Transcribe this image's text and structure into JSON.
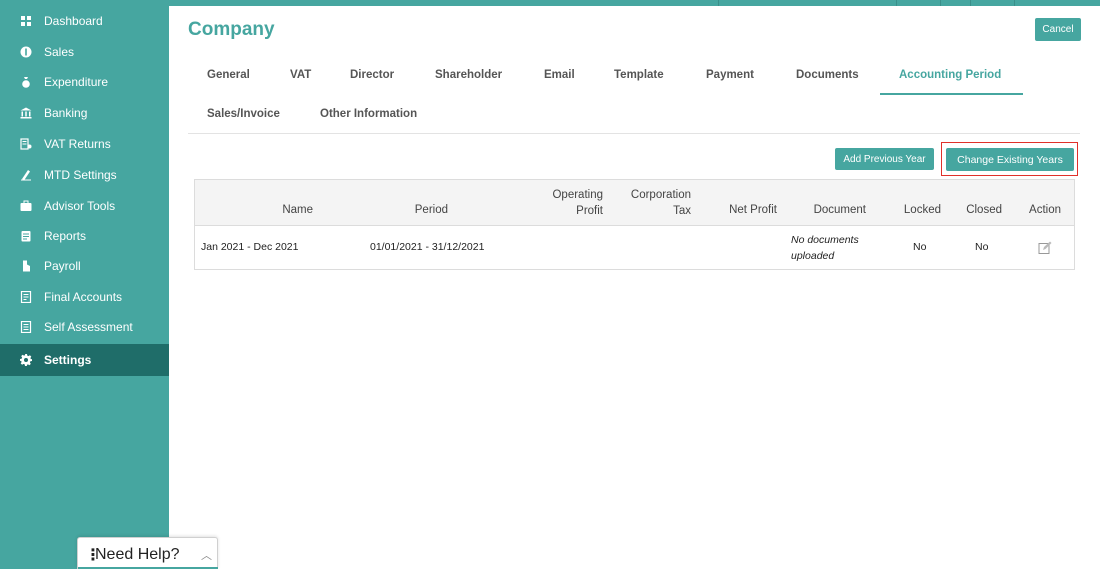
{
  "colors": {
    "accent": "#46a6a0",
    "sidebar_active": "#1f6d69",
    "highlight": "#e0312a"
  },
  "sidebar": {
    "items": [
      {
        "label": "Dashboard",
        "icon": "dashboard-icon"
      },
      {
        "label": "Sales",
        "icon": "sales-icon"
      },
      {
        "label": "Expenditure",
        "icon": "expenditure-icon"
      },
      {
        "label": "Banking",
        "icon": "bank-icon"
      },
      {
        "label": "VAT Returns",
        "icon": "vat-returns-icon"
      },
      {
        "label": "MTD Settings",
        "icon": "mtd-settings-icon"
      },
      {
        "label": "Advisor Tools",
        "icon": "briefcase-icon"
      },
      {
        "label": "Reports",
        "icon": "reports-icon"
      },
      {
        "label": "Payroll",
        "icon": "payroll-icon"
      },
      {
        "label": "Final Accounts",
        "icon": "final-accounts-icon"
      },
      {
        "label": "Self Assessment",
        "icon": "self-assessment-icon"
      },
      {
        "label": "Settings",
        "icon": "gear-icon",
        "active": true
      }
    ]
  },
  "header": {
    "title": "Company",
    "cancel_label": "Cancel"
  },
  "tabs": [
    {
      "label": "General"
    },
    {
      "label": "VAT"
    },
    {
      "label": "Director"
    },
    {
      "label": "Shareholder"
    },
    {
      "label": "Email"
    },
    {
      "label": "Template"
    },
    {
      "label": "Payment"
    },
    {
      "label": "Documents"
    },
    {
      "label": "Accounting Period",
      "active": true
    },
    {
      "label": "Sales/Invoice"
    },
    {
      "label": "Other Information"
    }
  ],
  "actions": {
    "add_previous_year": "Add Previous Year",
    "change_existing_years": "Change Existing Years"
  },
  "table": {
    "columns": [
      {
        "lines": [
          "Name"
        ]
      },
      {
        "lines": [
          "Period"
        ]
      },
      {
        "lines": [
          "Operating",
          "Profit"
        ]
      },
      {
        "lines": [
          "Corporation",
          "Tax"
        ]
      },
      {
        "lines": [
          "Net Profit"
        ]
      },
      {
        "lines": [
          "Document"
        ]
      },
      {
        "lines": [
          "Locked"
        ]
      },
      {
        "lines": [
          "Closed"
        ]
      },
      {
        "lines": [
          "Action"
        ]
      }
    ],
    "rows": [
      {
        "name": "Jan 2021 - Dec 2021",
        "period": "01/01/2021 - 31/12/2021",
        "operating_profit": "",
        "corporation_tax": "",
        "net_profit": "",
        "document_lines": [
          "No documents",
          "uploaded"
        ],
        "locked": "No",
        "closed": "No",
        "action_icon": "edit-icon"
      }
    ]
  },
  "help": {
    "label": "Need Help?",
    "icon": "chevron-up-icon"
  }
}
